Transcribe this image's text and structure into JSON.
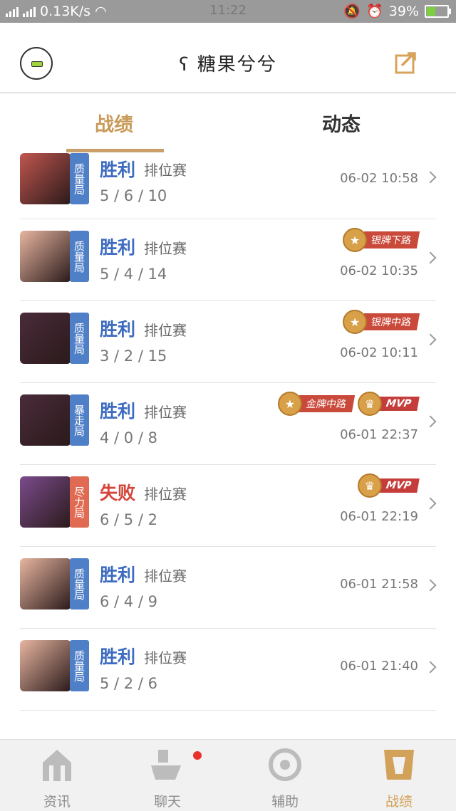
{
  "status_bar": {
    "signal_left": "2G",
    "signal_right": "4G",
    "net_speed": "0.13K/s",
    "time": "11:22",
    "battery": "39%",
    "battery_level": 0.39
  },
  "header": {
    "title": "ʕ 糖果兮兮"
  },
  "tabs": [
    {
      "label": "战绩",
      "active": true
    },
    {
      "label": "动态",
      "active": false
    }
  ],
  "matches": [
    {
      "tag": "质量局",
      "tag_color": "#4f7fc7",
      "result": "胜利",
      "result_color": "#3d6cc0",
      "mode": "排位赛",
      "kda": "5 / 6 / 10",
      "time": "06-02 10:58",
      "badges": [],
      "hero_color": "#c0564f"
    },
    {
      "tag": "质量局",
      "tag_color": "#4f7fc7",
      "result": "胜利",
      "result_color": "#3d6cc0",
      "mode": "排位赛",
      "kda": "5 / 4 / 14",
      "time": "06-02 10:35",
      "badges": [
        {
          "label": "银牌下路",
          "type": "medal"
        }
      ],
      "hero_color": "#e7b5a0"
    },
    {
      "tag": "质量局",
      "tag_color": "#4f7fc7",
      "result": "胜利",
      "result_color": "#3d6cc0",
      "mode": "排位赛",
      "kda": "3 / 2 / 15",
      "time": "06-02 10:11",
      "badges": [
        {
          "label": "银牌中路",
          "type": "medal"
        }
      ],
      "hero_color": "#4a2b3a"
    },
    {
      "tag": "暴走局",
      "tag_color": "#4f7fc7",
      "result": "胜利",
      "result_color": "#3d6cc0",
      "mode": "排位赛",
      "kda": "4 / 0 / 8",
      "time": "06-01 22:37",
      "badges": [
        {
          "label": "金牌中路",
          "type": "medal"
        },
        {
          "label": "MVP",
          "type": "mvp"
        }
      ],
      "hero_color": "#4a2b3a"
    },
    {
      "tag": "尽力局",
      "tag_color": "#e06a52",
      "result": "失败",
      "result_color": "#d6453a",
      "mode": "排位赛",
      "kda": "6 / 5 / 2",
      "time": "06-01 22:19",
      "badges": [
        {
          "label": "MVP",
          "type": "mvp"
        }
      ],
      "hero_color": "#7b4b8c"
    },
    {
      "tag": "质量局",
      "tag_color": "#4f7fc7",
      "result": "胜利",
      "result_color": "#3d6cc0",
      "mode": "排位赛",
      "kda": "6 / 4 / 9",
      "time": "06-01 21:58",
      "badges": [],
      "hero_color": "#e7b5a0"
    },
    {
      "tag": "质量局",
      "tag_color": "#4f7fc7",
      "result": "胜利",
      "result_color": "#3d6cc0",
      "mode": "排位赛",
      "kda": "5 / 2 / 6",
      "time": "06-01 21:40",
      "badges": [],
      "hero_color": "#e7b5a0"
    }
  ],
  "nav": [
    {
      "label": "资讯",
      "icon": "news-icon",
      "active": false
    },
    {
      "label": "聊天",
      "icon": "chat-icon",
      "active": false,
      "dot": true
    },
    {
      "label": "辅助",
      "icon": "assist-icon",
      "active": false
    },
    {
      "label": "战绩",
      "icon": "record-icon",
      "active": true
    }
  ],
  "colors": {
    "accent": "#c99a57",
    "win": "#3d6cc0",
    "loss": "#d6453a"
  }
}
